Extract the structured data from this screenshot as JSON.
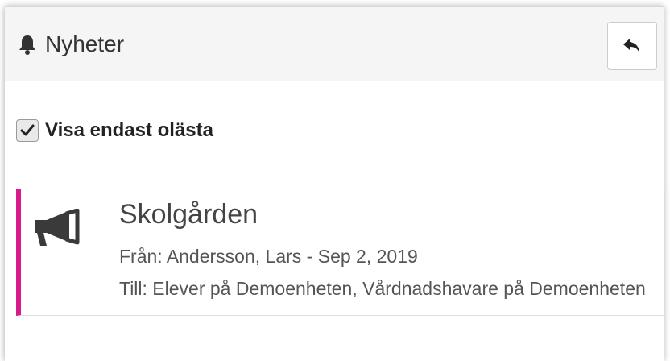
{
  "header": {
    "title": "Nyheter",
    "title_icon": "bell-icon",
    "back_button_icon": "reply-arrow-icon"
  },
  "filter": {
    "label": "Visa endast olästa",
    "checked": true
  },
  "news": [
    {
      "icon": "megaphone-icon",
      "accent_color": "#d81b8c",
      "title": "Skolgården",
      "from": "Från: Andersson, Lars - Sep 2, 2019",
      "to": "Till: Elever på Demoenheten, Vårdnadshavare på Demoenheten"
    }
  ],
  "colors": {
    "header_bg": "#f5f5f5",
    "accent": "#d81b8c",
    "text": "#333333"
  }
}
